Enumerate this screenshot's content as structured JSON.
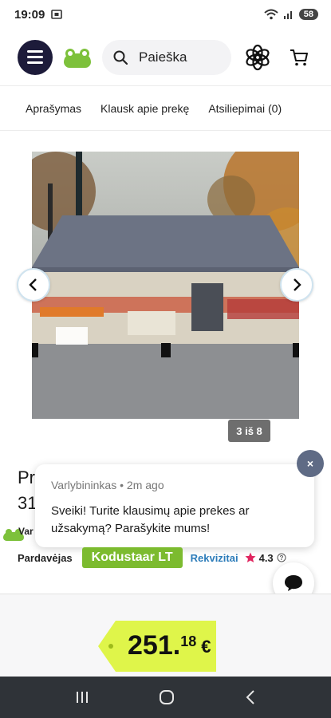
{
  "status_bar": {
    "time": "19:09",
    "battery": "58"
  },
  "header": {
    "search_placeholder": "Paieška"
  },
  "tabs": [
    {
      "label": "Aprašymas"
    },
    {
      "label": "Klausk apie prekę"
    },
    {
      "label": "Atsiliepimai (0)"
    }
  ],
  "gallery": {
    "counter": "3 iš 8"
  },
  "product": {
    "title_fragment": "Pr",
    "title_fragment2": "31",
    "var_fragment": "Var"
  },
  "chat": {
    "author": "Varlybininkas",
    "time": "2m ago",
    "separator": "•",
    "message": "Sveiki! Turite klausimų apie prekes ar užsakymą? Parašykite mums!",
    "close_label": "×"
  },
  "seller": {
    "label": "Pardavėjas",
    "name": "Kodustaar LT",
    "requisites_label": "Rekvizitai",
    "rating": "4.3"
  },
  "price": {
    "integer": "251.",
    "decimal": "18",
    "currency": "€"
  },
  "colors": {
    "accent_green": "#7cbb2f",
    "price_tag": "#dff54a",
    "link_blue": "#2b7bb9",
    "star_red": "#e0245e"
  }
}
